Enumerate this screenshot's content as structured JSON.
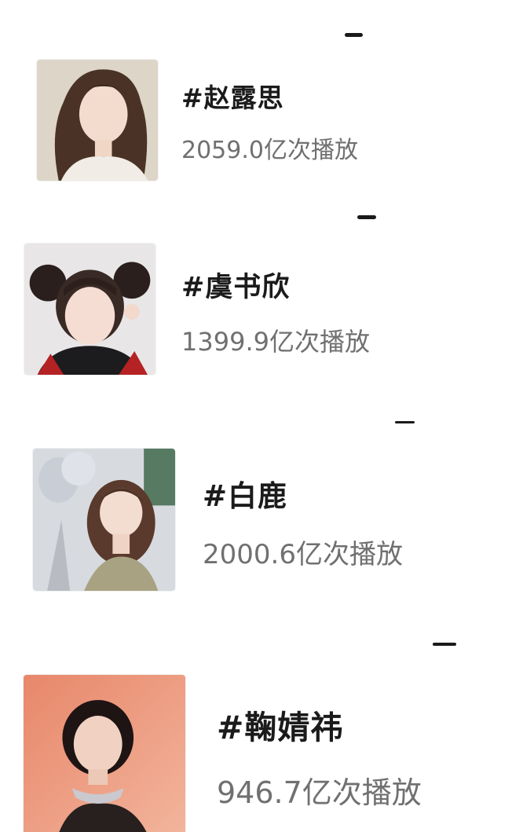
{
  "items": [
    {
      "name": "#赵露思",
      "plays": "2059.0亿次播放",
      "avatar": "portrait-photo"
    },
    {
      "name": "#虞书欣",
      "plays": "1399.9亿次播放",
      "avatar": "portrait-photo"
    },
    {
      "name": "#白鹿",
      "plays": "2000.6亿次播放",
      "avatar": "portrait-photo"
    },
    {
      "name": "#鞠婧祎",
      "plays": "946.7亿次播放",
      "avatar": "portrait-photo"
    }
  ],
  "colors": {
    "title": "#1b1b1b",
    "subtitle": "#707070",
    "background": "#ffffff"
  }
}
